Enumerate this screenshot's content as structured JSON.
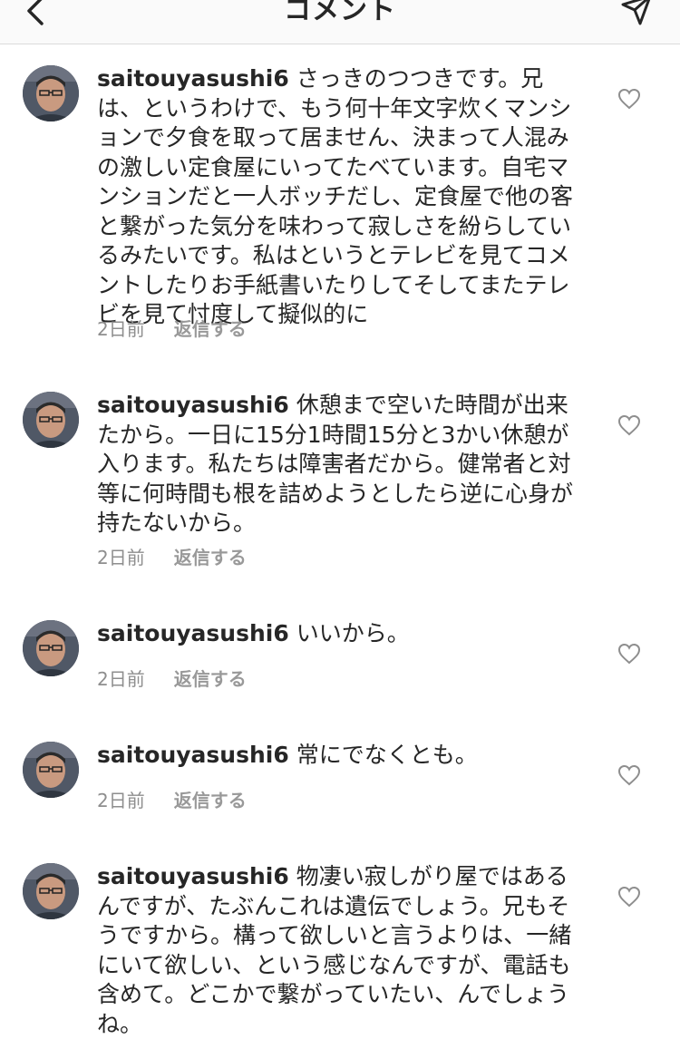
{
  "header": {
    "title": "コメント",
    "back_icon": "chevron-left-icon",
    "send_icon": "paper-plane-icon"
  },
  "comments": [
    {
      "username": "saitouyasushi6",
      "text": "さっきのつつきです。兄は、というわけで、もう何十年文字炊くマンションで夕食を取って居ません、決まって人混みの激しい定食屋にいってたべています。自宅マンションだと一人ボッチだし、定食屋で他の客と繋がった気分を味わって寂しさを紛らしているみたいです。私はというとテレビを見てコメントしたりお手紙書いたりしてそしてまたテレビを見て忖度して擬似的に",
      "time": "2日前",
      "reply": "返信する"
    },
    {
      "username": "saitouyasushi6",
      "text": "休憩まで空いた時間が出来たから。一日に15分1時間15分と3かい休憩が入ります。私たちは障害者だから。健常者と対等に何時間も根を詰めようとしたら逆に心身が持たないから。",
      "time": "2日前",
      "reply": "返信する"
    },
    {
      "username": "saitouyasushi6",
      "text": "いいから。",
      "time": "2日前",
      "reply": "返信する"
    },
    {
      "username": "saitouyasushi6",
      "text": "常にでなくとも。",
      "time": "2日前",
      "reply": "返信する"
    },
    {
      "username": "saitouyasushi6",
      "text": "物凄い寂しがり屋ではあるんですが、たぶんこれは遺伝でしょう。兄もそうですから。構って欲しいと言うよりは、一緒にいて欲しい、という感じなんですが、電話も含めて。どこかで繋がっていたい、んでしょうね。"
    }
  ],
  "colors": {
    "text": "#262626",
    "meta": "#8e8e8e",
    "header_bg": "#fafafa",
    "divider": "#dbdbdb"
  }
}
